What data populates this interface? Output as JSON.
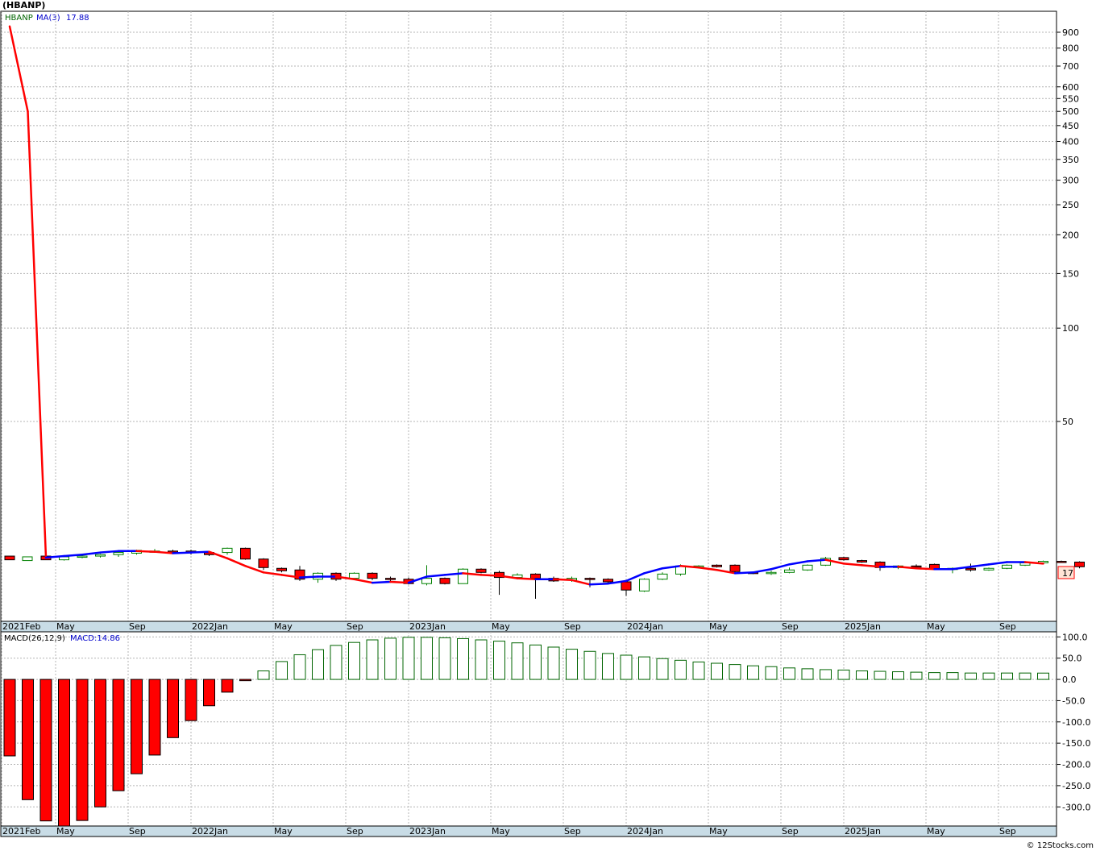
{
  "title": "(HBANP)",
  "legend": {
    "ticker": "HBANP",
    "ma_label": "MA(3)",
    "ma_value": "17.88",
    "macd_label": "MACD(26,12,9)",
    "macd_value_label": "MACD:14.86"
  },
  "last_price_tag": "17",
  "watermark": "© 12Stocks.com",
  "colors": {
    "up": "#008000",
    "down": "#ff0000",
    "ma_rising": "#0000ff",
    "ma_falling": "#ff0000",
    "macd_neg": "#ff0000",
    "macd_pos": "#006400",
    "grid": "#b4b4b4",
    "axis_band": "#c8dce6"
  },
  "x_axis_labels": [
    "2021Feb",
    "May",
    "Sep",
    "2022Jan",
    "May",
    "Sep",
    "2023Jan",
    "May",
    "Sep",
    "2024Jan",
    "May",
    "Sep",
    "2025Jan",
    "May",
    "Sep"
  ],
  "chart_data": [
    {
      "type": "candlestick",
      "title": "(HBANP)",
      "scale": "log",
      "ylim": [
        13,
        1000
      ],
      "y_ticks": [
        50,
        100,
        150,
        200,
        250,
        300,
        350,
        400,
        450,
        500,
        550,
        600,
        700,
        800,
        900
      ],
      "grid": true,
      "x_labels": [
        "2021Feb",
        "May",
        "Sep",
        "2022Jan",
        "May",
        "Sep",
        "2023Jan",
        "May",
        "Sep",
        "2024Jan",
        "May",
        "Sep",
        "2025Jan",
        "May",
        "Sep"
      ],
      "candles": [
        {
          "o": 18.4,
          "h": 18.6,
          "l": 17.9,
          "c": 17.9
        },
        {
          "o": 17.9,
          "h": 18.4,
          "l": 17.8,
          "c": 18.3
        },
        {
          "o": 18.3,
          "h": 18.6,
          "l": 18.1,
          "c": 18.4
        },
        {
          "o": 18.4,
          "h": 18.7,
          "l": 18.2,
          "c": 18.6
        },
        {
          "o": 18.6,
          "h": 19.0,
          "l": 18.3,
          "c": 18.9
        },
        {
          "o": 18.8,
          "h": 19.3,
          "l": 18.6,
          "c": 19.2
        },
        {
          "o": 19.1,
          "h": 19.4,
          "l": 18.9,
          "c": 19.1
        },
        {
          "o": 19.1,
          "h": 19.3,
          "l": 18.8,
          "c": 19.0
        },
        {
          "o": 19.1,
          "h": 19.3,
          "l": 18.6,
          "c": 18.9
        },
        {
          "o": 18.9,
          "h": 19.1,
          "l": 18.4,
          "c": 18.6
        },
        {
          "o": 18.9,
          "h": 19.6,
          "l": 18.6,
          "c": 19.5
        },
        {
          "o": 19.5,
          "h": 19.6,
          "l": 17.9,
          "c": 18.0
        },
        {
          "o": 18.0,
          "h": 18.1,
          "l": 16.6,
          "c": 16.9
        },
        {
          "o": 16.8,
          "h": 16.9,
          "l": 16.3,
          "c": 16.5
        },
        {
          "o": 16.6,
          "h": 17.1,
          "l": 15.3,
          "c": 15.5
        },
        {
          "o": 15.5,
          "h": 16.3,
          "l": 15.1,
          "c": 16.2
        },
        {
          "o": 16.2,
          "h": 16.3,
          "l": 15.3,
          "c": 15.5
        },
        {
          "o": 15.6,
          "h": 16.3,
          "l": 15.5,
          "c": 16.2
        },
        {
          "o": 16.2,
          "h": 16.3,
          "l": 15.4,
          "c": 15.6
        },
        {
          "o": 15.6,
          "h": 15.8,
          "l": 15.2,
          "c": 15.5
        },
        {
          "o": 15.5,
          "h": 15.7,
          "l": 14.9,
          "c": 15.0
        },
        {
          "o": 15.0,
          "h": 17.2,
          "l": 14.8,
          "c": 15.6
        },
        {
          "o": 15.6,
          "h": 15.7,
          "l": 14.9,
          "c": 15.0
        },
        {
          "o": 15.0,
          "h": 16.8,
          "l": 15.0,
          "c": 16.7
        },
        {
          "o": 16.7,
          "h": 16.8,
          "l": 16.2,
          "c": 16.3
        },
        {
          "o": 16.3,
          "h": 16.5,
          "l": 13.8,
          "c": 15.7
        },
        {
          "o": 15.7,
          "h": 16.2,
          "l": 15.5,
          "c": 16.0
        },
        {
          "o": 16.1,
          "h": 16.2,
          "l": 13.4,
          "c": 15.6
        },
        {
          "o": 15.6,
          "h": 15.8,
          "l": 15.2,
          "c": 15.3
        },
        {
          "o": 15.4,
          "h": 15.8,
          "l": 15.2,
          "c": 15.6
        },
        {
          "o": 15.6,
          "h": 15.7,
          "l": 14.6,
          "c": 15.5
        },
        {
          "o": 15.5,
          "h": 15.6,
          "l": 15.1,
          "c": 15.2
        },
        {
          "o": 15.2,
          "h": 15.3,
          "l": 13.7,
          "c": 14.3
        },
        {
          "o": 14.2,
          "h": 15.6,
          "l": 14.1,
          "c": 15.5
        },
        {
          "o": 15.5,
          "h": 16.3,
          "l": 15.4,
          "c": 16.1
        },
        {
          "o": 16.1,
          "h": 17.3,
          "l": 15.9,
          "c": 17.1
        },
        {
          "o": 17.1,
          "h": 17.2,
          "l": 17.0,
          "c": 17.1
        },
        {
          "o": 17.2,
          "h": 17.3,
          "l": 16.9,
          "c": 17.0
        },
        {
          "o": 17.2,
          "h": 17.3,
          "l": 16.2,
          "c": 16.4
        },
        {
          "o": 16.3,
          "h": 16.4,
          "l": 16.1,
          "c": 16.2
        },
        {
          "o": 16.2,
          "h": 16.5,
          "l": 16.0,
          "c": 16.3
        },
        {
          "o": 16.3,
          "h": 16.9,
          "l": 16.2,
          "c": 16.6
        },
        {
          "o": 16.6,
          "h": 17.3,
          "l": 16.5,
          "c": 17.2
        },
        {
          "o": 17.2,
          "h": 18.3,
          "l": 17.1,
          "c": 18.1
        },
        {
          "o": 18.2,
          "h": 18.3,
          "l": 17.8,
          "c": 17.9
        },
        {
          "o": 17.8,
          "h": 17.9,
          "l": 17.5,
          "c": 17.6
        },
        {
          "o": 17.6,
          "h": 17.7,
          "l": 16.5,
          "c": 16.9
        },
        {
          "o": 16.9,
          "h": 17.2,
          "l": 16.7,
          "c": 17.1
        },
        {
          "o": 17.1,
          "h": 17.3,
          "l": 16.9,
          "c": 17.0
        },
        {
          "o": 17.3,
          "h": 17.4,
          "l": 16.6,
          "c": 16.7
        },
        {
          "o": 16.7,
          "h": 16.9,
          "l": 16.2,
          "c": 16.8
        },
        {
          "o": 16.8,
          "h": 17.4,
          "l": 16.4,
          "c": 16.6
        },
        {
          "o": 16.6,
          "h": 16.9,
          "l": 16.5,
          "c": 16.8
        },
        {
          "o": 16.8,
          "h": 17.3,
          "l": 16.7,
          "c": 17.2
        },
        {
          "o": 17.2,
          "h": 17.6,
          "l": 17.1,
          "c": 17.5
        },
        {
          "o": 17.5,
          "h": 17.8,
          "l": 17.4,
          "c": 17.7
        },
        {
          "o": 17.7,
          "h": 17.8,
          "l": 17.5,
          "c": 17.6
        },
        {
          "o": 17.6,
          "h": 17.7,
          "l": 16.8,
          "c": 17.0
        }
      ],
      "series": [
        {
          "name": "MA(3)",
          "values": [
            940,
            500,
            18.2,
            18.4,
            18.6,
            18.9,
            19.1,
            19.1,
            19.0,
            18.8,
            18.9,
            19.0,
            18.1,
            17.1,
            16.3,
            16.0,
            15.7,
            15.8,
            15.8,
            15.5,
            15.1,
            15.2,
            15.1,
            15.8,
            16.0,
            16.2,
            16.0,
            15.9,
            15.6,
            15.5,
            15.5,
            15.4,
            14.9,
            15.0,
            15.3,
            16.2,
            16.8,
            17.1,
            16.9,
            16.6,
            16.2,
            16.3,
            16.7,
            17.3,
            17.7,
            17.9,
            17.4,
            17.2,
            17.0,
            17.0,
            16.8,
            16.7,
            16.7,
            17.0,
            17.3,
            17.6,
            17.6,
            17.4
          ]
        }
      ]
    },
    {
      "type": "bar",
      "title": "MACD(26,12,9)",
      "ylim": [
        -345,
        112
      ],
      "y_ticks": [
        100,
        50,
        0,
        -50,
        -100,
        -150,
        -200,
        -250,
        -300
      ],
      "grid": true,
      "x_labels": [
        "2021Feb",
        "May",
        "Sep",
        "2022Jan",
        "May",
        "Sep",
        "2023Jan",
        "May",
        "Sep",
        "2024Jan",
        "May",
        "Sep",
        "2025Jan",
        "May",
        "Sep"
      ],
      "series": [
        {
          "name": "MACD",
          "values": [
            -180,
            -283,
            -333,
            -345,
            -332,
            -300,
            -262,
            -222,
            -178,
            -137,
            -97,
            -62,
            -30,
            -3,
            20,
            42,
            58,
            70,
            80,
            87,
            93,
            97,
            99,
            99,
            98,
            96,
            93,
            90,
            86,
            81,
            76,
            71,
            66,
            61,
            57,
            53,
            49,
            45,
            41,
            38,
            35,
            32,
            30,
            27,
            25,
            23,
            22,
            20,
            19,
            18,
            17,
            16,
            16,
            15,
            15,
            15,
            15,
            14.86
          ]
        }
      ]
    }
  ]
}
